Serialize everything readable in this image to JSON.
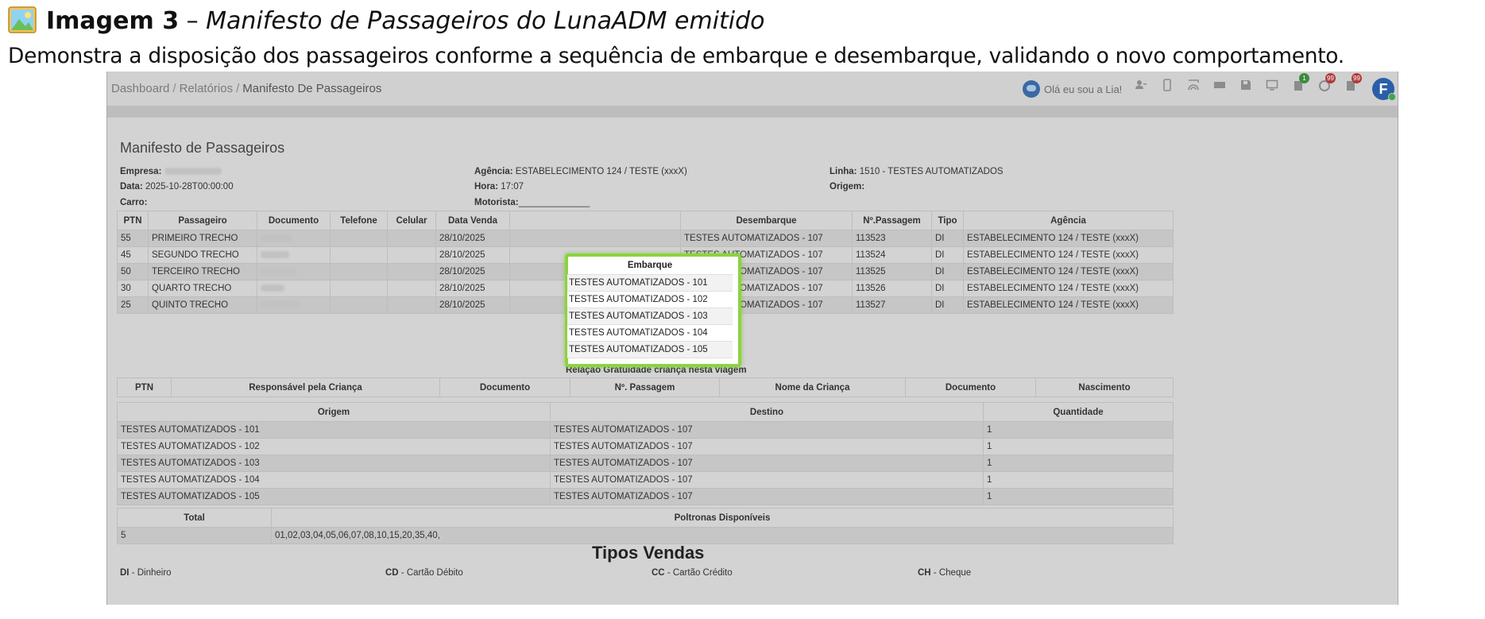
{
  "doc": {
    "title_bold": "Imagem 3",
    "title_dash": " – ",
    "title_italic": "Manifesto de Passageiros do LunaADM emitido",
    "subtitle": "Demonstra a disposição dos passageiros conforme a sequência de embarque e desembarque, validando o novo comportamento."
  },
  "breadcrumb": {
    "items": [
      "Dashboard",
      "Relatórios",
      "Manifesto De Passageiros"
    ],
    "separator": "/"
  },
  "header": {
    "lia_text": "Olá eu sou a Lia!",
    "icons": [
      "user-icon",
      "mobile-icon",
      "wifi-icon",
      "ticket-icon",
      "save-icon",
      "monitor-icon",
      "clipboard-icon",
      "refresh-icon",
      "notes-icon"
    ],
    "badges": {
      "clipboard": "1",
      "refresh": "99",
      "notes": "99"
    },
    "avatar_letter": "F"
  },
  "manifest": {
    "title": "Manifesto de Passageiros",
    "empresa_label": "Empresa:",
    "data_label": "Data:",
    "data_value": "2025-10-28T00:00:00",
    "carro_label": "Carro:",
    "agencia_label": "Agência:",
    "agencia_value": "ESTABELECIMENTO 124 / TESTE (xxxX)",
    "hora_label": "Hora:",
    "hora_value": "17:07",
    "motorista_label": "Motorista:",
    "motorista_value": "______________",
    "linha_label": "Linha:",
    "linha_value": "1510 - TESTES AUTOMATIZADOS",
    "origem_label": "Origem:"
  },
  "passengers": {
    "columns": [
      "PTN",
      "Passageiro",
      "Documento",
      "Telefone",
      "Celular",
      "Data Venda",
      "Embarque",
      "Desembarque",
      "Nº.Passagem",
      "Tipo",
      "Agência"
    ],
    "rows": [
      {
        "ptn": "55",
        "passageiro": "PRIMEIRO TRECHO",
        "data_venda": "28/10/2025",
        "embarque": "TESTES AUTOMATIZADOS - 101",
        "desembarque": "TESTES AUTOMATIZADOS - 107",
        "passagem": "113523",
        "tipo": "DI",
        "agencia": "ESTABELECIMENTO 124 / TESTE (xxxX)"
      },
      {
        "ptn": "45",
        "passageiro": "SEGUNDO TRECHO",
        "data_venda": "28/10/2025",
        "embarque": "TESTES AUTOMATIZADOS - 102",
        "desembarque": "TESTES AUTOMATIZADOS - 107",
        "passagem": "113524",
        "tipo": "DI",
        "agencia": "ESTABELECIMENTO 124 / TESTE (xxxX)"
      },
      {
        "ptn": "50",
        "passageiro": "TERCEIRO TRECHO",
        "data_venda": "28/10/2025",
        "embarque": "TESTES AUTOMATIZADOS - 103",
        "desembarque": "TESTES AUTOMATIZADOS - 107",
        "passagem": "113525",
        "tipo": "DI",
        "agencia": "ESTABELECIMENTO 124 / TESTE (xxxX)"
      },
      {
        "ptn": "30",
        "passageiro": "QUARTO TRECHO",
        "data_venda": "28/10/2025",
        "embarque": "TESTES AUTOMATIZADOS - 104",
        "desembarque": "TESTES AUTOMATIZADOS - 107",
        "passagem": "113526",
        "tipo": "DI",
        "agencia": "ESTABELECIMENTO 124 / TESTE (xxxX)"
      },
      {
        "ptn": "25",
        "passageiro": "QUINTO TRECHO",
        "data_venda": "28/10/2025",
        "embarque": "TESTES AUTOMATIZADOS - 105",
        "desembarque": "TESTES AUTOMATIZADOS - 107",
        "passagem": "113527",
        "tipo": "DI",
        "agencia": "ESTABELECIMENTO 124 / TESTE (xxxX)"
      }
    ]
  },
  "gratuidade": {
    "title": "Relação Gratuidade criança nesta viagem",
    "columns": [
      "PTN",
      "Responsável pela Criança",
      "Documento",
      "Nº. Passagem",
      "Nome da Criança",
      "Documento",
      "Nascimento"
    ]
  },
  "od": {
    "columns": [
      "Origem",
      "Destino",
      "Quantidade"
    ],
    "rows": [
      [
        "TESTES AUTOMATIZADOS - 101",
        "TESTES AUTOMATIZADOS - 107",
        "1"
      ],
      [
        "TESTES AUTOMATIZADOS - 102",
        "TESTES AUTOMATIZADOS - 107",
        "1"
      ],
      [
        "TESTES AUTOMATIZADOS - 103",
        "TESTES AUTOMATIZADOS - 107",
        "1"
      ],
      [
        "TESTES AUTOMATIZADOS - 104",
        "TESTES AUTOMATIZADOS - 107",
        "1"
      ],
      [
        "TESTES AUTOMATIZADOS - 105",
        "TESTES AUTOMATIZADOS - 107",
        "1"
      ]
    ]
  },
  "totals": {
    "columns": [
      "Total",
      "Poltronas Disponíveis"
    ],
    "total": "5",
    "poltronas": "01,02,03,04,05,06,07,08,10,15,20,35,40,"
  },
  "tipos": {
    "title": "Tipos Vendas",
    "items": [
      {
        "code": "DI",
        "label": " - Dinheiro"
      },
      {
        "code": "CD",
        "label": " - Cartão Débito"
      },
      {
        "code": "CC",
        "label": " - Cartão Crédito"
      },
      {
        "code": "CH",
        "label": " - Cheque"
      }
    ]
  }
}
